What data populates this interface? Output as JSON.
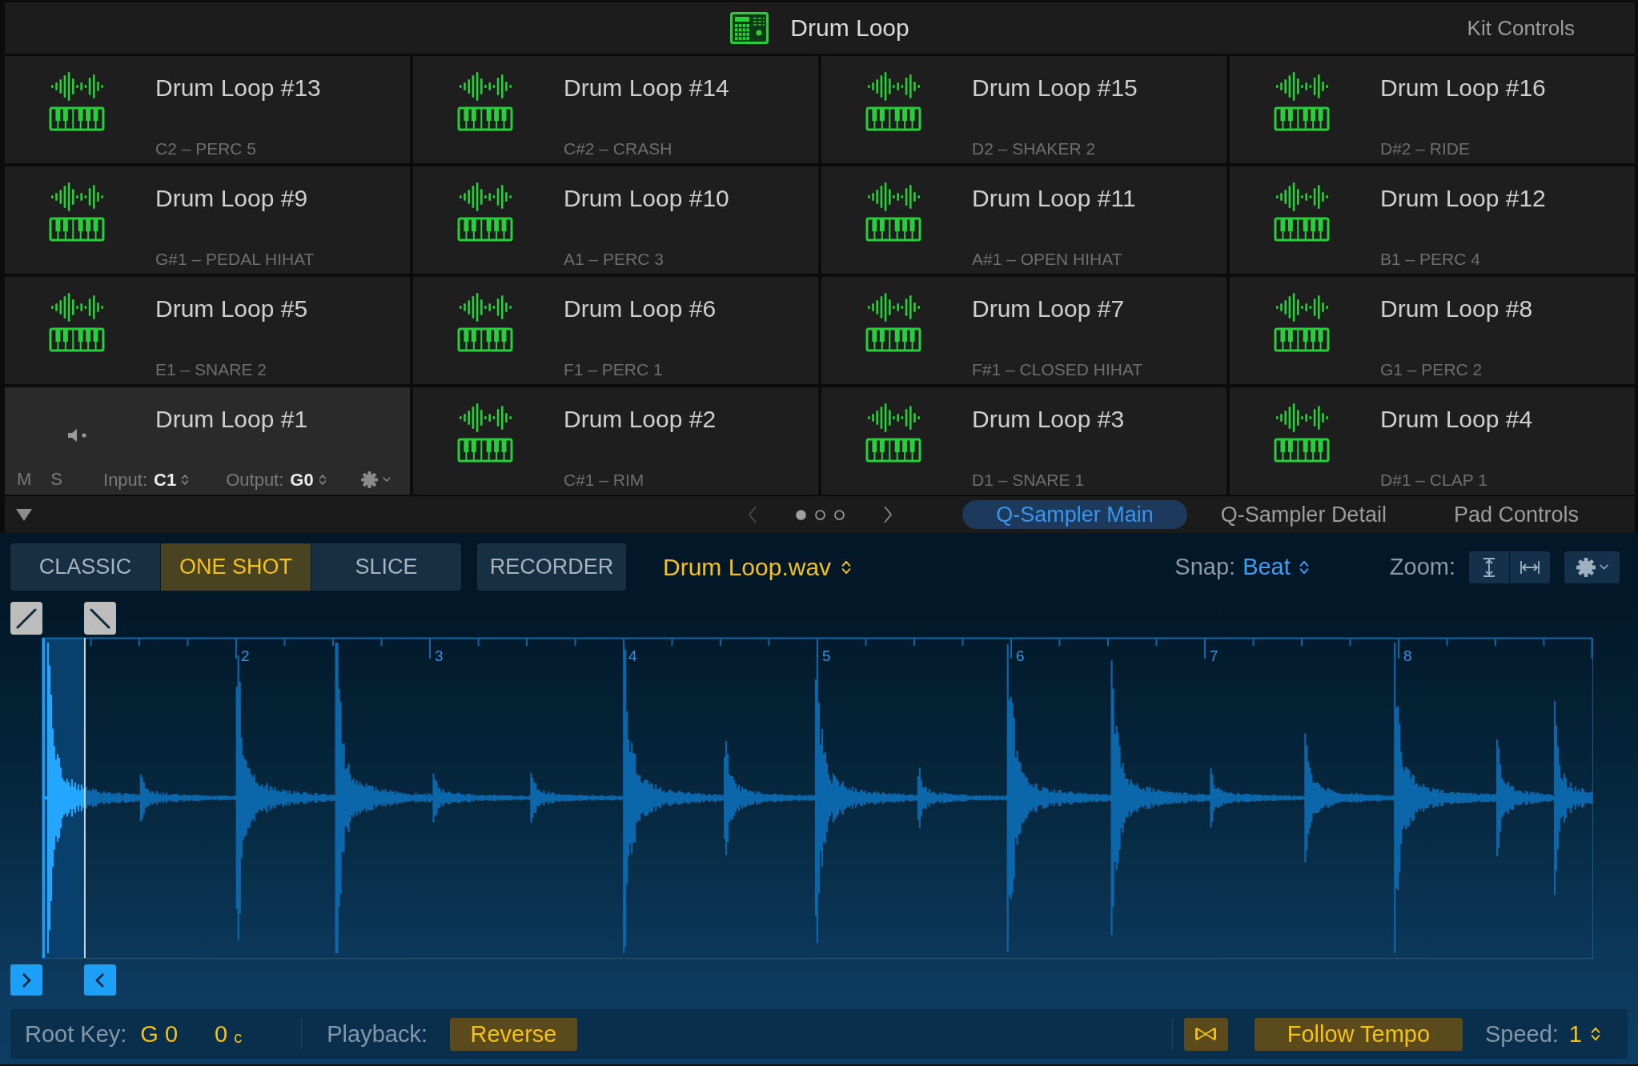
{
  "header": {
    "title": "Drum Loop",
    "kit_controls": "Kit Controls"
  },
  "pads": [
    {
      "name": "Drum Loop #13",
      "note": "C2 – PERC 5",
      "selected": false
    },
    {
      "name": "Drum Loop #14",
      "note": "C#2 – CRASH",
      "selected": false
    },
    {
      "name": "Drum Loop #15",
      "note": "D2 – SHAKER 2",
      "selected": false
    },
    {
      "name": "Drum Loop #16",
      "note": "D#2 – RIDE",
      "selected": false
    },
    {
      "name": "Drum Loop #9",
      "note": "G#1 – PEDAL HIHAT",
      "selected": false
    },
    {
      "name": "Drum Loop #10",
      "note": "A1 – PERC 3",
      "selected": false
    },
    {
      "name": "Drum Loop #11",
      "note": "A#1 – OPEN HIHAT",
      "selected": false
    },
    {
      "name": "Drum Loop #12",
      "note": "B1 – PERC 4",
      "selected": false
    },
    {
      "name": "Drum Loop #5",
      "note": "E1 – SNARE 2",
      "selected": false
    },
    {
      "name": "Drum Loop #6",
      "note": "F1 – PERC 1",
      "selected": false
    },
    {
      "name": "Drum Loop #7",
      "note": "F#1 – CLOSED HIHAT",
      "selected": false
    },
    {
      "name": "Drum Loop #8",
      "note": "G1 – PERC 2",
      "selected": false
    },
    {
      "name": "Drum Loop #1",
      "selected": true,
      "controls": {
        "mute": "M",
        "solo": "S",
        "input_label": "Input:",
        "input_value": "C1",
        "output_label": "Output:",
        "output_value": "G0"
      }
    },
    {
      "name": "Drum Loop #2",
      "note": "C#1 – RIM",
      "selected": false
    },
    {
      "name": "Drum Loop #3",
      "note": "D1 – SNARE 1",
      "selected": false
    },
    {
      "name": "Drum Loop #4",
      "note": "D#1 – CLAP 1",
      "selected": false
    }
  ],
  "pager": {
    "pages": [
      {
        "selected": true
      },
      {
        "selected": false
      },
      {
        "selected": false
      }
    ]
  },
  "view_tabs": [
    {
      "label": "Q-Sampler Main",
      "selected": true
    },
    {
      "label": "Q-Sampler Detail",
      "selected": false
    },
    {
      "label": "Pad Controls",
      "selected": false
    }
  ],
  "toolbar": {
    "modes": [
      {
        "label": "CLASSIC",
        "selected": false
      },
      {
        "label": "ONE SHOT",
        "selected": true
      },
      {
        "label": "SLICE",
        "selected": false
      }
    ],
    "recorder": "RECORDER",
    "sample_file": "Drum Loop.wav",
    "snap_label": "Snap:",
    "snap_value": "Beat",
    "zoom_label": "Zoom:"
  },
  "waveform": {
    "bar_labels": [
      "2",
      "3",
      "4",
      "5",
      "6",
      "7",
      "8"
    ]
  },
  "footer": {
    "root_key_label": "Root Key:",
    "root_key": "G 0",
    "fine_tune": "0",
    "fine_tune_unit": "c",
    "playback_label": "Playback:",
    "reverse": {
      "label": "Reverse",
      "on": true
    },
    "bowtie_toggle": {
      "on": true
    },
    "follow_tempo": {
      "label": "Follow Tempo",
      "on": true
    },
    "speed_label": "Speed:",
    "speed_value": "1"
  }
}
